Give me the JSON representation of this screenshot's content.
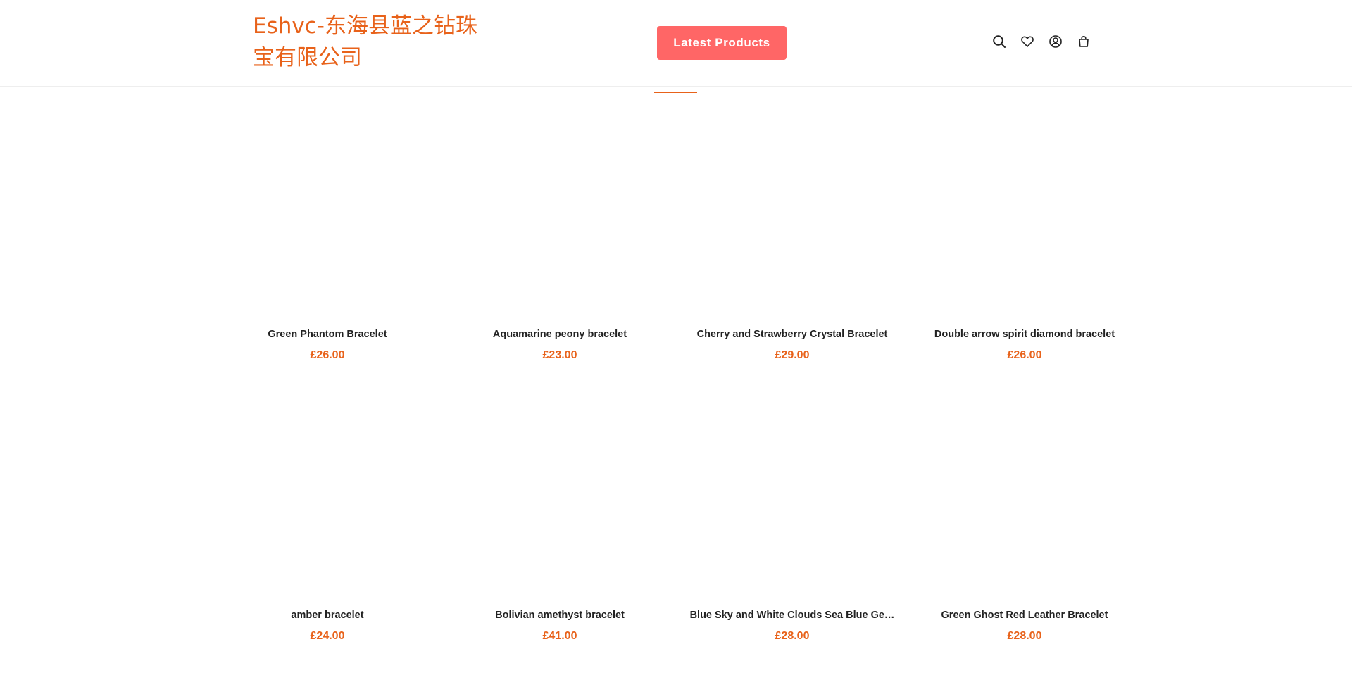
{
  "header": {
    "brand": "Eshvc-东海县蓝之钻珠宝有限公司",
    "cta_label": "Latest Products",
    "icons": [
      "search-icon",
      "heart-icon",
      "account-icon",
      "cart-icon"
    ]
  },
  "colors": {
    "accent": "#e8621a",
    "cta": "#ff6666",
    "text": "#222222"
  },
  "products": [
    {
      "title": "Green Phantom Bracelet",
      "price": "£26.00"
    },
    {
      "title": "Aquamarine peony bracelet",
      "price": "£23.00"
    },
    {
      "title": "Cherry and Strawberry Crystal Bracelet",
      "price": "£29.00"
    },
    {
      "title": "Double arrow spirit diamond bracelet",
      "price": "£26.00"
    },
    {
      "title": "amber bracelet",
      "price": "£24.00"
    },
    {
      "title": "Bolivian amethyst bracelet",
      "price": "£41.00"
    },
    {
      "title": "Blue Sky and White Clouds Sea Blue Ge…",
      "price": "£28.00"
    },
    {
      "title": "Green Ghost Red Leather Bracelet",
      "price": "£28.00"
    }
  ]
}
